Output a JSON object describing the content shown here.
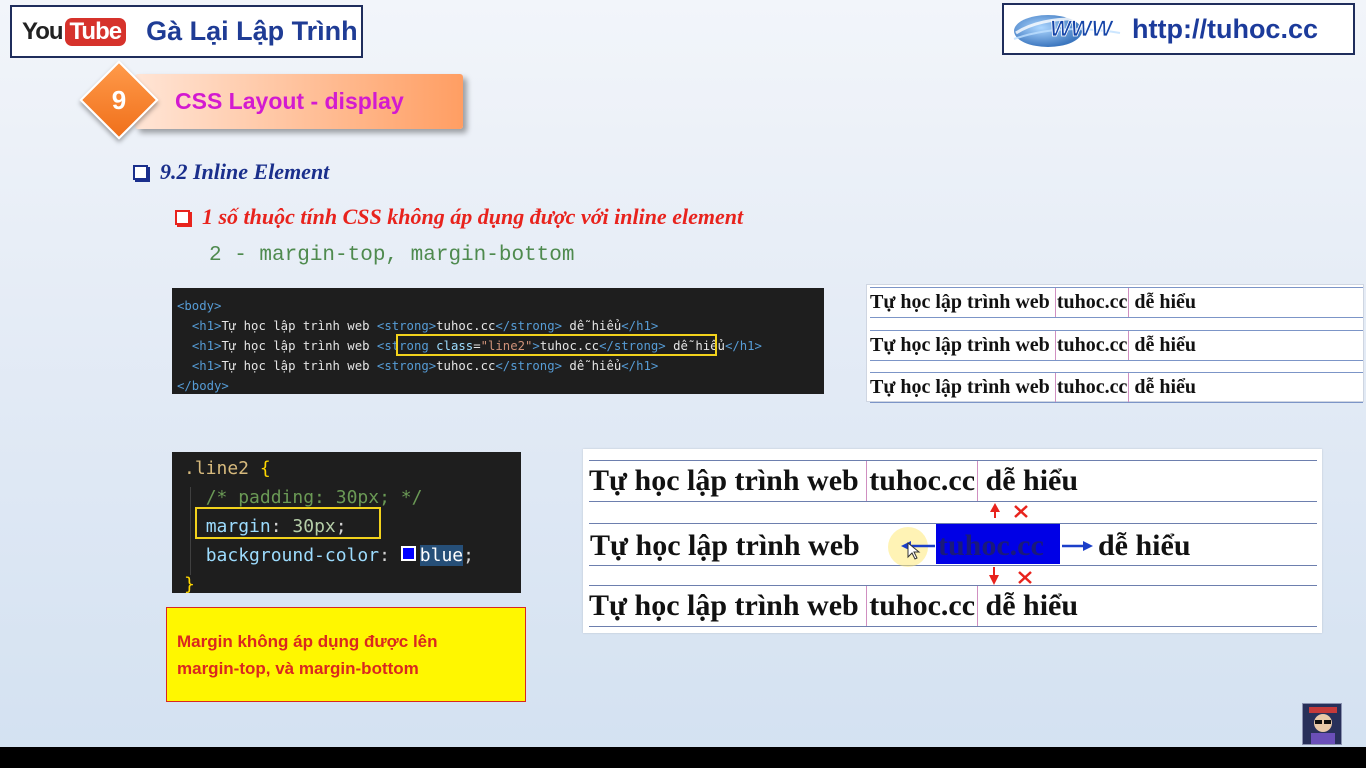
{
  "header": {
    "youtube_you": "You",
    "youtube_tube": "Tube",
    "channel_name": "Gà Lại Lập Trình",
    "site_url": "http://tuhoc.cc"
  },
  "section": {
    "number": "9",
    "title": "CSS Layout - display"
  },
  "headings": {
    "h1": "9.2 Inline Element",
    "h2": "1 số thuộc tính CSS không áp dụng được với inline element",
    "h3": "2 - margin-top, margin-bottom"
  },
  "html_code": {
    "body_open": "<body>",
    "body_close": "</body>",
    "h1_open": "<h1>",
    "h1_close": "</h1>",
    "strong_open": "<strong>",
    "strong_close": "</strong>",
    "strong_class_open": "<strong",
    "class_attr": "class",
    "class_eq": "=",
    "class_value": "\"line2\"",
    "tag_gt": ">",
    "text_before": "Tự học lập trình web ",
    "strong_text": "tuhoc.cc",
    "text_after": " dễ hiểu"
  },
  "preview_small": {
    "rows": [
      {
        "before": "Tự học lập trình web ",
        "strong": "tuhoc.cc",
        "after": " dễ hiểu"
      },
      {
        "before": "Tự học lập trình web ",
        "strong": "tuhoc.cc",
        "after": " dễ hiểu"
      },
      {
        "before": "Tự học lập trình web ",
        "strong": "tuhoc.cc",
        "after": " dễ hiểu"
      }
    ]
  },
  "css_code": {
    "selector": ".line2",
    "brace_open": "{",
    "brace_close": "}",
    "comment": "/* padding: 30px; */",
    "margin_prop": "margin",
    "margin_value": "30px",
    "bg_prop": "background-color",
    "bg_value": "blue",
    "colon": ": ",
    "semicolon": ";"
  },
  "note": {
    "line1": "Margin không áp dụng được lên",
    "line2": "margin-top, và margin-bottom"
  },
  "preview_large": {
    "row1": {
      "before": "Tự học lập trình web ",
      "strong": "tuhoc.cc",
      "after": " dễ hiểu"
    },
    "row2": {
      "before": "Tự học lập trình web",
      "strong": "tuhoc.cc",
      "after": "dễ hiểu"
    },
    "row3": {
      "before": "Tự học lập trình web ",
      "strong": "tuhoc.cc",
      "after": " dễ hiểu"
    }
  },
  "colors": {
    "title_blue": "#1f3c95",
    "section_magenta": "#d31ad0",
    "heading_red": "#e8231d",
    "highlight_yellow": "#f2d21c",
    "inline_bg_blue": "#0000e6"
  }
}
